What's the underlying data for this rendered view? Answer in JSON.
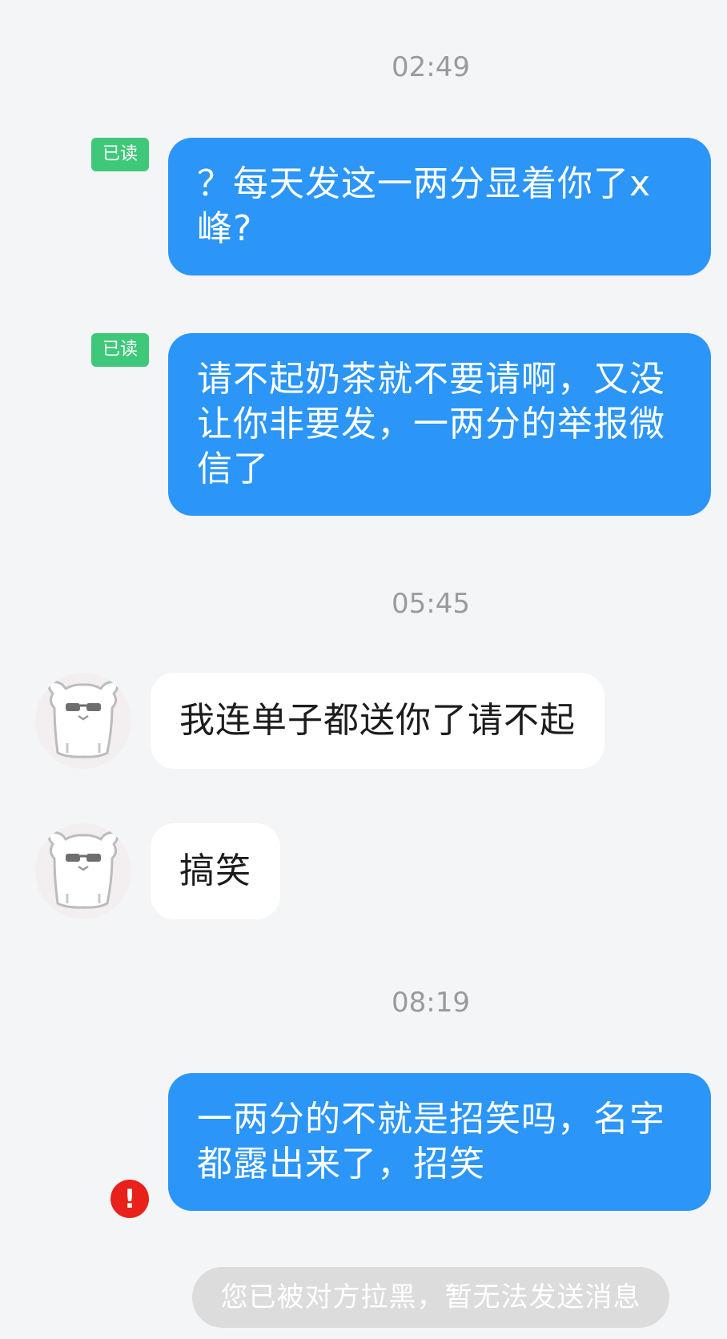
{
  "messages": [
    {
      "type": "timestamp",
      "text": "02:49"
    },
    {
      "type": "outgoing",
      "status": "已读",
      "text": "？每天发这一两分显着你了x峰?"
    },
    {
      "type": "outgoing",
      "status": "已读",
      "text": "请不起奶茶就不要请啊，又没让你非要发，一两分的举报微信了"
    },
    {
      "type": "timestamp",
      "text": "05:45"
    },
    {
      "type": "incoming",
      "text": "我连单子都送你了请不起"
    },
    {
      "type": "incoming",
      "text": "搞笑"
    },
    {
      "type": "timestamp",
      "text": "08:19"
    },
    {
      "type": "outgoing",
      "status": "!",
      "text": "一两分的不就是招笑吗，名字都露出来了，招笑"
    }
  ],
  "system_notice": "您已被对方拉黑，暂无法发送消息",
  "colors": {
    "outgoing_bubble": "#2b95f8",
    "incoming_bubble": "#ffffff",
    "read_badge": "#3fc87a",
    "error_icon": "#e8221b",
    "background": "#f4f5f7",
    "notice_bg": "#dcdcdc"
  },
  "icons": {
    "avatar": "cartoon-bear-with-sunglasses-avatar",
    "send_failed": "exclamation-error-icon"
  }
}
